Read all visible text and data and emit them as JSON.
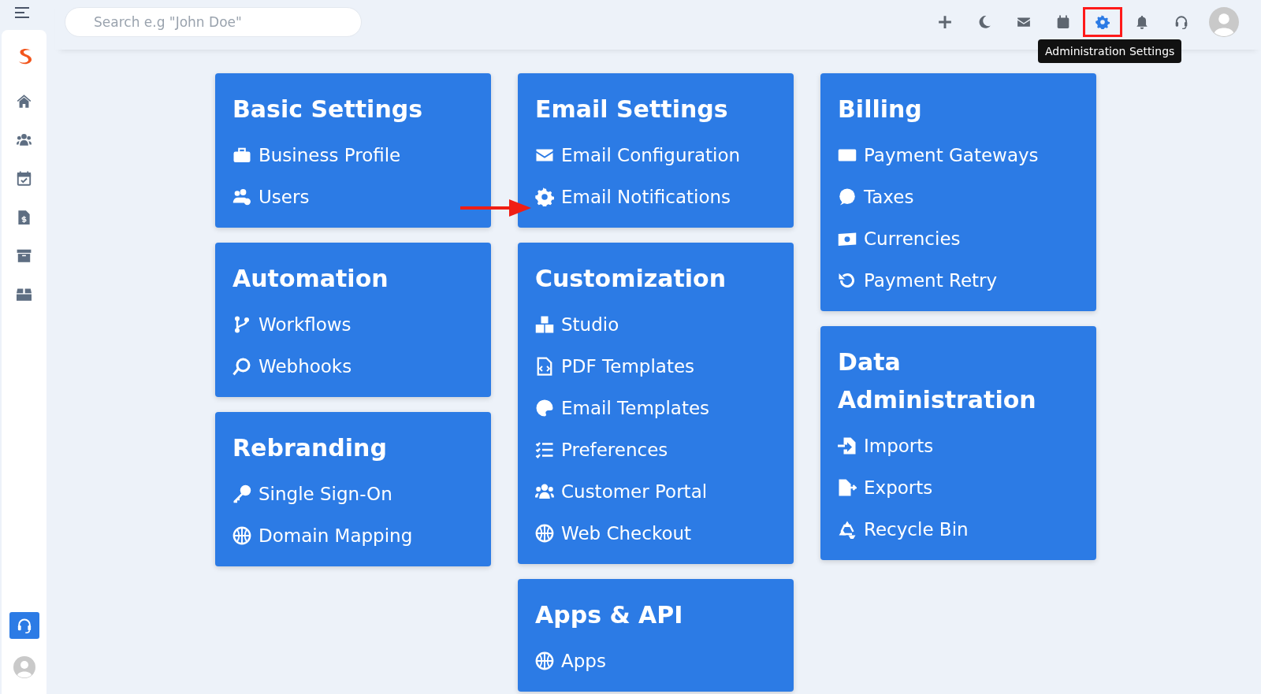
{
  "search": {
    "placeholder": "Search e.g \"John Doe\""
  },
  "toolbar": [
    {
      "selected": false
    },
    {
      "selected": false
    },
    {
      "selected": false
    },
    {
      "selected": false
    },
    {
      "selected": true
    },
    {
      "selected": false
    },
    {
      "selected": false
    }
  ],
  "tooltip": "Administration Settings",
  "columns": [
    [
      {
        "title": "Basic Settings",
        "items": [
          "Business Profile",
          "Users"
        ]
      },
      {
        "title": "Automation",
        "items": [
          "Workflows",
          "Webhooks"
        ]
      },
      {
        "title": "Rebranding",
        "items": [
          "Single Sign-On",
          "Domain Mapping"
        ]
      }
    ],
    [
      {
        "title": "Email Settings",
        "items": [
          "Email Configuration",
          "Email Notifications"
        ]
      },
      {
        "title": "Customization",
        "items": [
          "Studio",
          "PDF Templates",
          "Email Templates",
          "Preferences",
          "Customer Portal",
          "Web Checkout"
        ]
      },
      {
        "title": "Apps & API",
        "items": [
          "Apps"
        ]
      }
    ],
    [
      {
        "title": "Billing",
        "items": [
          "Payment Gateways",
          "Taxes",
          "Currencies",
          "Payment Retry"
        ]
      },
      {
        "title": "Data Administration",
        "items": [
          "Imports",
          "Exports",
          "Recycle Bin"
        ]
      }
    ]
  ]
}
